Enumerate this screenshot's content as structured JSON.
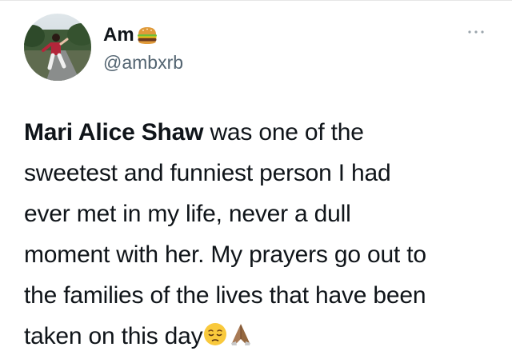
{
  "author": {
    "display_name": "Am",
    "name_emoji": "hamburger-emoji",
    "handle": "@ambxrb",
    "avatar": "profile-photo"
  },
  "tweet": {
    "mention": "Mari Alice Shaw",
    "lines": [
      " was one of the",
      "sweetest and funniest person I had",
      "ever met in my life, never a dull",
      "moment with her. My prayers go out to",
      "the families of the lives that have been",
      "taken on this day"
    ],
    "trailing_emojis": [
      "pensive-face-emoji",
      "folded-hands-emoji"
    ]
  },
  "icons": {
    "more": "more-options-icon"
  },
  "colors": {
    "text": "#0f1419",
    "secondary_text": "#536471",
    "background": "#ffffff"
  }
}
